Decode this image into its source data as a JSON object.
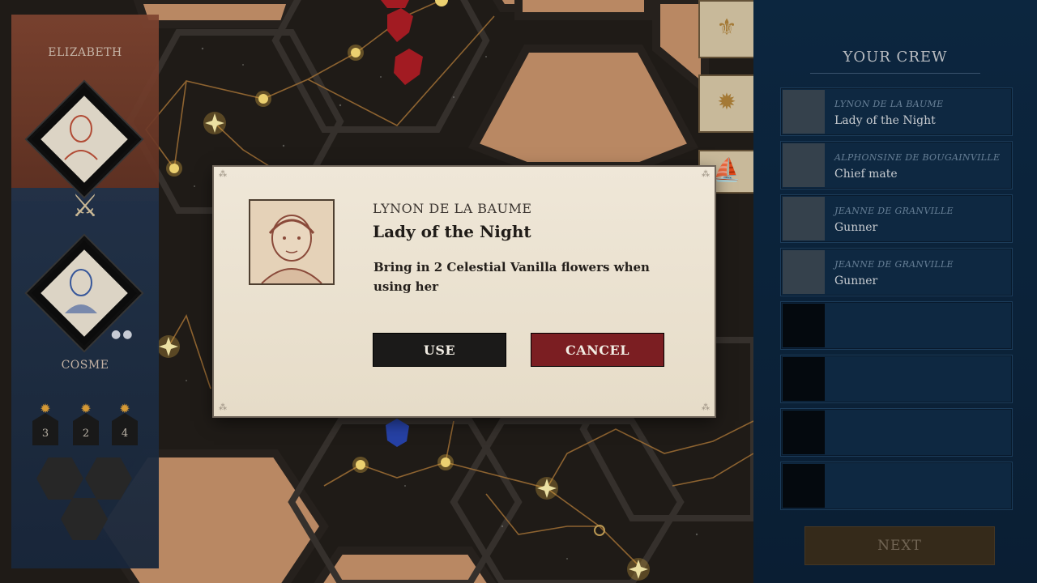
{
  "players": {
    "top": {
      "name": "ELIZABETH"
    },
    "bottom": {
      "name": "COSME",
      "tokens": [
        "3",
        "2",
        "4"
      ]
    }
  },
  "colors": {
    "player_top": "#8a4a34",
    "player_bottom": "#24364f",
    "cancel_button": "#7b1e22",
    "use_button": "#1b1a19",
    "panel": "#0e2a45"
  },
  "crew_panel": {
    "title": "YOUR CREW",
    "slots": [
      {
        "name": "LYNON DE LA BAUME",
        "role": "Lady of the Night"
      },
      {
        "name": "ALPHONSINE DE BOUGAINVILLE",
        "role": "Chief mate"
      },
      {
        "name": "JEANNE DE GRANVILLE",
        "role": "Gunner"
      },
      {
        "name": "JEANNE DE GRANVILLE",
        "role": "Gunner"
      },
      {
        "name": "",
        "role": ""
      },
      {
        "name": "",
        "role": ""
      },
      {
        "name": "",
        "role": ""
      },
      {
        "name": "",
        "role": ""
      }
    ],
    "next_label": "NEXT"
  },
  "dialog": {
    "name": "LYNON DE LA BAUME",
    "role": "Lady of the Night",
    "description": "Bring in 2 Celestial Vanilla flowers when using her",
    "use_label": "USE",
    "cancel_label": "CANCEL"
  },
  "icons": {
    "fleur_de_lis": "⚜",
    "compass": "✹",
    "ship": "⛵",
    "swords": "⚔"
  }
}
